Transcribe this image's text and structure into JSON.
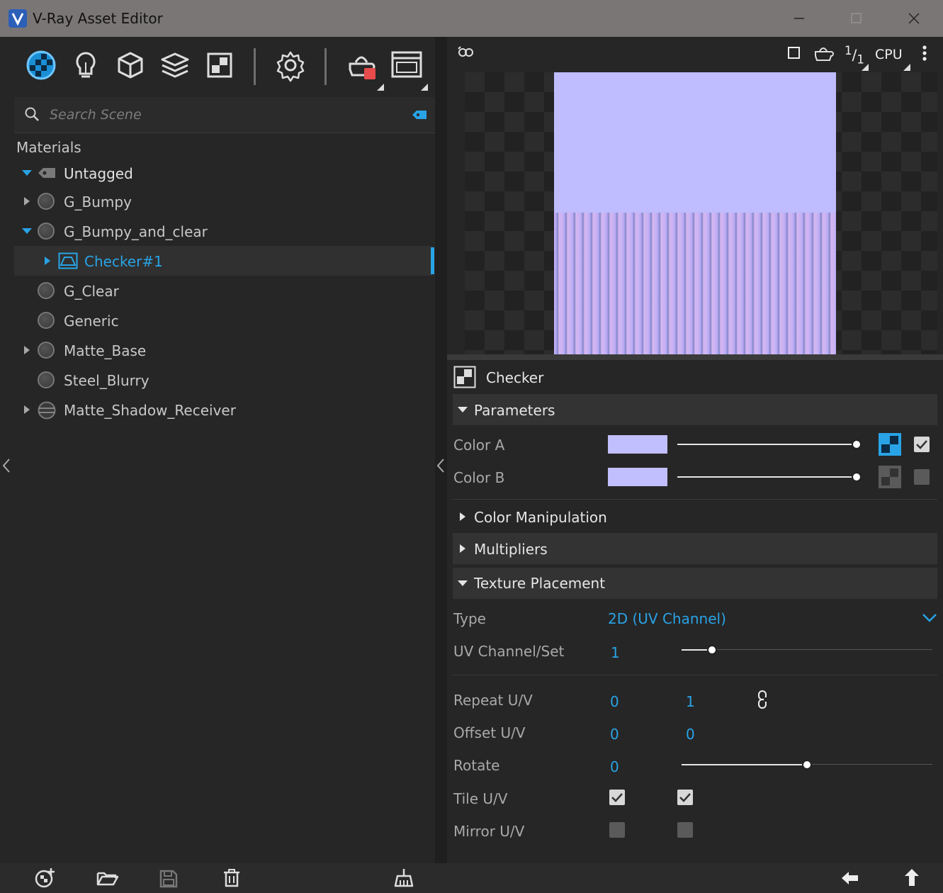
{
  "window": {
    "title": "V-Ray Asset Editor"
  },
  "toolbar": {
    "items": [
      "materials-icon",
      "lights-icon",
      "geometry-icon",
      "layers-icon",
      "textures-icon",
      "settings-icon",
      "render-icon",
      "frame-buffer-icon"
    ]
  },
  "search": {
    "placeholder": "Search Scene"
  },
  "tree": {
    "header": "Materials",
    "tag": "Untagged",
    "items": [
      {
        "label": "G_Bumpy"
      },
      {
        "label": "G_Bumpy_and_clear"
      },
      {
        "label": "Checker#1"
      },
      {
        "label": "G_Clear"
      },
      {
        "label": "Generic"
      },
      {
        "label": "Matte_Base"
      },
      {
        "label": "Steel_Blurry"
      },
      {
        "label": "Matte_Shadow_Receiver"
      }
    ]
  },
  "preview": {
    "ratio_label_num": "1",
    "ratio_label_den": "1",
    "engine": "CPU",
    "colors": {
      "swatch": "#bfbcff"
    }
  },
  "texture": {
    "name": "Checker",
    "sections": {
      "parameters": "Parameters",
      "color_manipulation": "Color Manipulation",
      "multipliers": "Multipliers",
      "texture_placement": "Texture Placement"
    },
    "color_a": {
      "label": "Color A",
      "color": "#c2bfff",
      "enabled": true
    },
    "color_b": {
      "label": "Color B",
      "color": "#c2bfff",
      "enabled": false
    },
    "placement": {
      "type_label": "Type",
      "type_value": "2D (UV Channel)",
      "uv_label": "UV Channel/Set",
      "uv_value": "1",
      "repeat_label": "Repeat U/V",
      "repeat_u": "0",
      "repeat_v": "1",
      "offset_label": "Offset U/V",
      "offset_u": "0",
      "offset_v": "0",
      "rotate_label": "Rotate",
      "rotate_value": "0",
      "tile_label": "Tile U/V",
      "tile_u": true,
      "tile_v": true,
      "mirror_label": "Mirror U/V",
      "mirror_u": false,
      "mirror_v": false
    }
  },
  "colors": {
    "accent": "#29a3e6",
    "panel": "#262626",
    "titlebar": "#7b7676"
  }
}
